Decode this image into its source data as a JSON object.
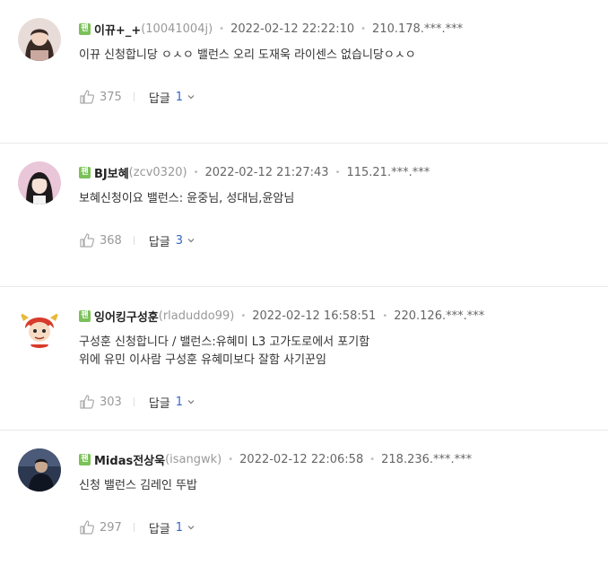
{
  "badge_label": "팬",
  "reply_label": "답글",
  "comments": [
    {
      "nickname": "이뀨+_+",
      "user_id": "(10041004j)",
      "date": "2022-02-12 22:22:10",
      "ip": "210.178.***.***",
      "lines": [
        "이뀨 신청합니당 ㅇㅅㅇ 밸런스 오리 도재욱  라이센스 없습니당ㅇㅅㅇ"
      ],
      "likes": "375",
      "replies": "1",
      "avatar_color": "#c9a8a0"
    },
    {
      "nickname": "BJ보혜",
      "user_id": "(zcv0320)",
      "date": "2022-02-12 21:27:43",
      "ip": "115.21.***.***",
      "lines": [
        "보혜신청이요 밸런스: 윤중님, 성대님,윤암님"
      ],
      "likes": "368",
      "replies": "3",
      "avatar_color": "#e9c6d8"
    },
    {
      "nickname": "잉어킹구성훈",
      "user_id": "(rladuddo99)",
      "date": "2022-02-12 16:58:51",
      "ip": "220.126.***.***",
      "lines": [
        "구성훈 신청합니다 / 밸런스:유혜미 L3 고가도로에서 포기함",
        "위에 유민 이사람 구성훈 유혜미보다 잘함 사기꾼임"
      ],
      "likes": "303",
      "replies": "1",
      "avatar_color": "#d93a2b"
    },
    {
      "nickname": "Midas전상욱",
      "user_id": "(isangwk)",
      "date": "2022-02-12 22:06:58",
      "ip": "218.236.***.***",
      "lines": [
        "신청 밸런스 김레인 뚜밥"
      ],
      "likes": "297",
      "replies": "1",
      "avatar_color": "#2c3850"
    }
  ]
}
